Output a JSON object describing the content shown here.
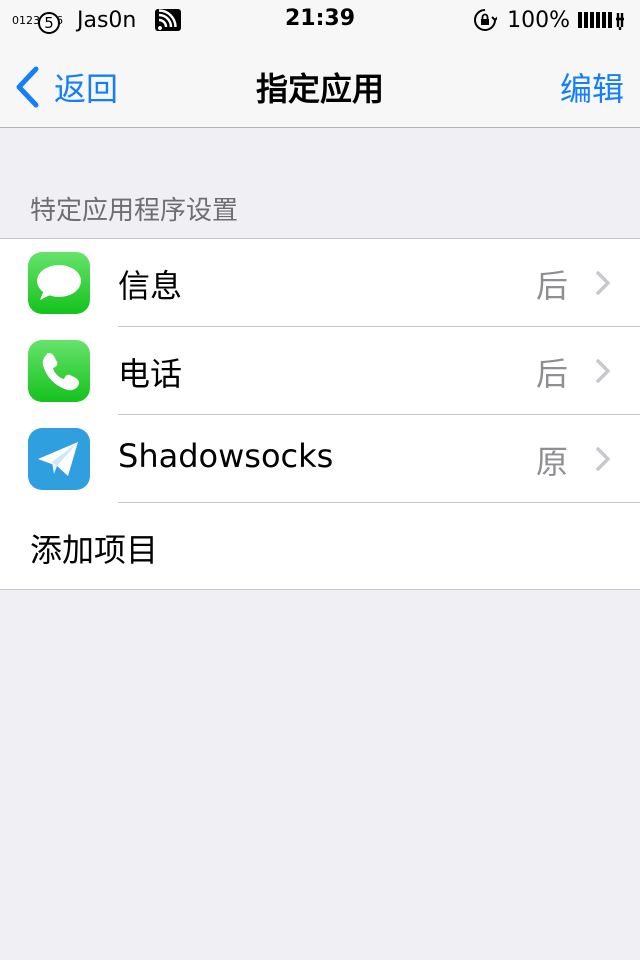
{
  "status_bar": {
    "small_digits": "0123",
    "small_digits_tail": "6",
    "circle_digit": "5",
    "carrier": "Jas0n",
    "time": "21:39",
    "battery_percent": "100%"
  },
  "nav": {
    "back_label": "返回",
    "title": "指定应用",
    "edit_label": "编辑"
  },
  "section": {
    "header": "特定应用程序设置",
    "items": [
      {
        "name": "信息",
        "detail": "后",
        "icon": "messages-icon"
      },
      {
        "name": "电话",
        "detail": "后",
        "icon": "phone-icon"
      },
      {
        "name": "Shadowsocks",
        "detail": "原",
        "icon": "shadowsocks-icon"
      }
    ],
    "add_label": "添加项目"
  },
  "colors": {
    "accent": "#157efb",
    "background": "#efeff4",
    "detail_text": "#8e8e93",
    "messages_green": "#34c759",
    "shadowsocks_blue": "#2f9fe0"
  }
}
